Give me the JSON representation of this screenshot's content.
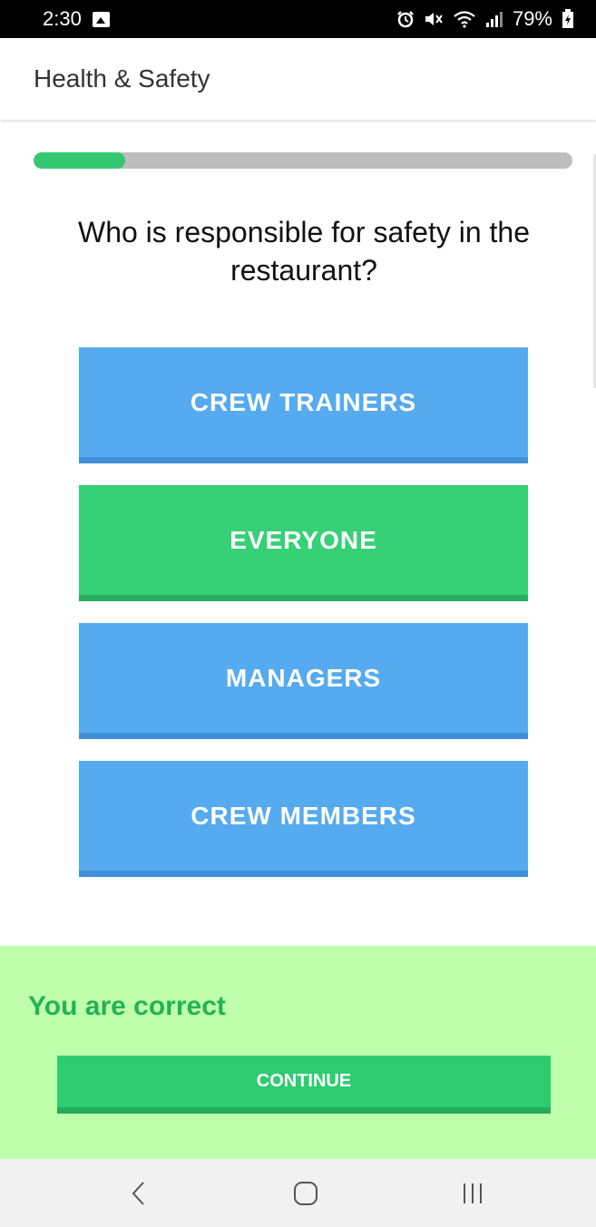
{
  "status_bar": {
    "time": "2:30",
    "battery": "79%"
  },
  "app_bar": {
    "title": "Health & Safety"
  },
  "progress": {
    "value_percent": 17,
    "fill_color": "#34c970"
  },
  "question": {
    "text": "Who is responsible for safety in the restaurant?"
  },
  "answers": [
    {
      "label": "CREW TRAINERS",
      "state": "default",
      "color": "#56aaef"
    },
    {
      "label": "EVERYONE",
      "state": "correct",
      "color": "#36d076"
    },
    {
      "label": "MANAGERS",
      "state": "default",
      "color": "#56aaef"
    },
    {
      "label": "CREW MEMBERS",
      "state": "default",
      "color": "#56aaef"
    }
  ],
  "feedback": {
    "message": "You are correct",
    "continue_label": "CONTINUE",
    "panel_color": "#bfffab"
  },
  "nav_bar": {
    "back_icon": "back-icon",
    "home_icon": "home-icon",
    "recents_icon": "recents-icon"
  }
}
